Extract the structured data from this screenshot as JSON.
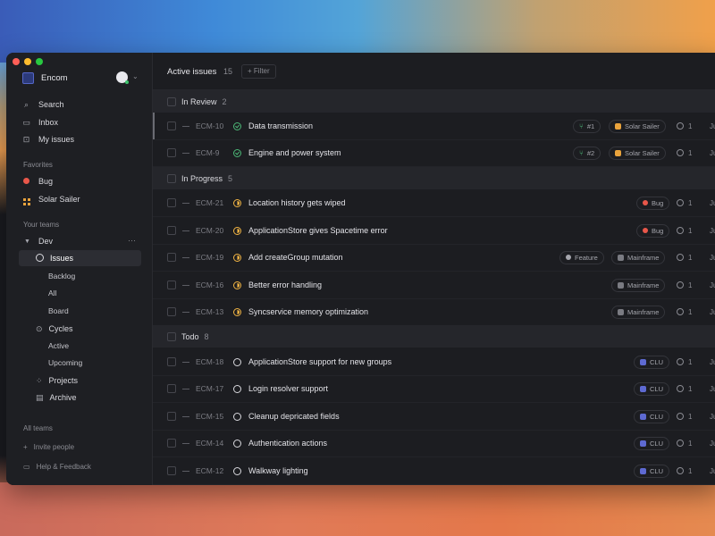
{
  "app": {
    "workspace": "Encom",
    "colors": {
      "accent": "#5e6ad2",
      "review": "#4cb877",
      "progress": "#f2b544",
      "bug": "#e9574a",
      "solar": "#e9a33c"
    }
  },
  "sidebar": {
    "nav": [
      {
        "label": "Search",
        "icon": "search-icon"
      },
      {
        "label": "Inbox",
        "icon": "inbox-icon"
      },
      {
        "label": "My issues",
        "icon": "my-issues-icon"
      }
    ],
    "favorites_label": "Favorites",
    "favorites": [
      {
        "label": "Bug",
        "icon": "bug-dot-icon"
      },
      {
        "label": "Solar Sailer",
        "icon": "grid-icon"
      }
    ],
    "teams_label": "Your teams",
    "team": {
      "name": "Dev",
      "more": "···"
    },
    "team_items": [
      {
        "label": "Issues"
      },
      {
        "label": "Backlog"
      },
      {
        "label": "All"
      },
      {
        "label": "Board"
      },
      {
        "label": "Cycles"
      },
      {
        "label": "Active"
      },
      {
        "label": "Upcoming"
      },
      {
        "label": "Projects"
      },
      {
        "label": "Archive"
      }
    ],
    "all_teams": "All teams",
    "invite": "Invite people",
    "help": "Help & Feedback"
  },
  "topbar": {
    "title": "Active issues",
    "count": "15",
    "filter": "+ Filter"
  },
  "groups": [
    {
      "title": "In Review",
      "count": "2"
    },
    {
      "title": "In Progress",
      "count": "5"
    },
    {
      "title": "Todo",
      "count": "8"
    }
  ],
  "rows": [
    {
      "id": "ECM-10",
      "title": "Data transmission",
      "pr": "#1",
      "label": "Solar Sailer",
      "estimate": "1",
      "date": "Ju"
    },
    {
      "id": "ECM-9",
      "title": "Engine and power system",
      "pr": "#2",
      "label": "Solar Sailer",
      "estimate": "1",
      "date": "Ju"
    },
    {
      "id": "ECM-21",
      "title": "Location history gets wiped",
      "label": "Bug",
      "estimate": "1",
      "date": "Ju"
    },
    {
      "id": "ECM-20",
      "title": "ApplicationStore gives Spacetime error",
      "label": "Bug",
      "estimate": "1",
      "date": "Ju"
    },
    {
      "id": "ECM-19",
      "title": "Add createGroup mutation",
      "label_extra": "Feature",
      "label": "Mainframe",
      "estimate": "1",
      "date": "Ju"
    },
    {
      "id": "ECM-16",
      "title": "Better error handling",
      "label": "Mainframe",
      "estimate": "1",
      "date": "Ju"
    },
    {
      "id": "ECM-13",
      "title": "Syncservice memory optimization",
      "label": "Mainframe",
      "estimate": "1",
      "date": "Ju"
    },
    {
      "id": "ECM-18",
      "title": "ApplicationStore support for new groups",
      "label": "CLU",
      "estimate": "1",
      "date": "Ju"
    },
    {
      "id": "ECM-17",
      "title": "Login resolver support",
      "label": "CLU",
      "estimate": "1",
      "date": "Ju"
    },
    {
      "id": "ECM-15",
      "title": "Cleanup depricated fields",
      "label": "CLU",
      "estimate": "1",
      "date": "Ju"
    },
    {
      "id": "ECM-14",
      "title": "Authentication actions",
      "label": "CLU",
      "estimate": "1",
      "date": "Ju"
    },
    {
      "id": "ECM-12",
      "title": "Walkway lighting",
      "label": "CLU",
      "estimate": "1",
      "date": "Ju"
    }
  ]
}
